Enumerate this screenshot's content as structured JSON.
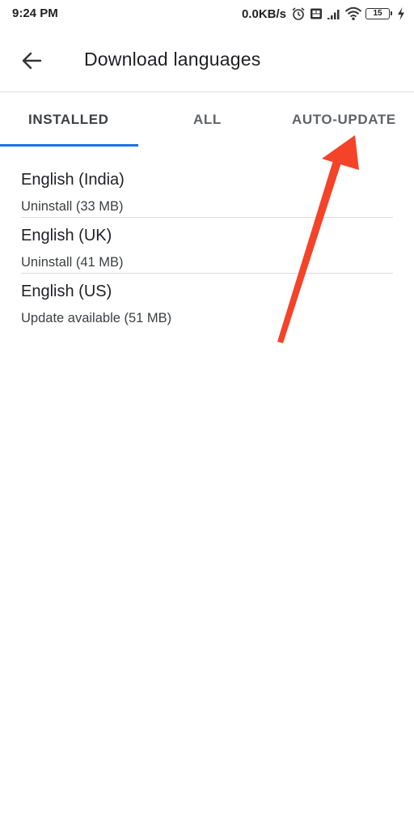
{
  "status_bar": {
    "time": "9:24 PM",
    "net_speed": "0.0KB/s",
    "battery_level": "15",
    "icons": [
      "alarm-icon",
      "sim-icon",
      "signal-icon",
      "wifi-icon",
      "battery-icon",
      "charging-icon"
    ]
  },
  "app_bar": {
    "title": "Download languages",
    "back_icon": "arrow-back-icon"
  },
  "tabs": [
    {
      "label": "INSTALLED",
      "selected": true
    },
    {
      "label": "ALL",
      "selected": false
    },
    {
      "label": "AUTO-UPDATE",
      "selected": false
    }
  ],
  "languages": [
    {
      "name": "English (India)",
      "status": "Uninstall (33 MB)"
    },
    {
      "name": "English (UK)",
      "status": "Uninstall (41 MB)"
    },
    {
      "name": "English (US)",
      "status": "Update available (51 MB)"
    }
  ],
  "colors": {
    "accent": "#1a73e8",
    "annotation_arrow": "#f44328"
  }
}
